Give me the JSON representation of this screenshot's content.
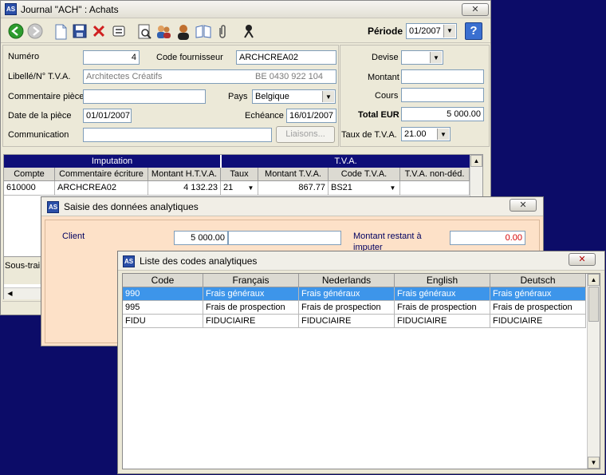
{
  "main": {
    "title": "Journal \"ACH\" : Achats",
    "close": "✕",
    "toolbar": {
      "periode_label": "Période",
      "periode_value": "01/2007",
      "help": "?"
    },
    "form": {
      "numero_label": "Numéro",
      "numero_value": "4",
      "code_fournisseur_label": "Code fournisseur",
      "code_fournisseur_value": "ARCHCREA02",
      "libelle_label": "Libellé/N° T.V.A.",
      "libelle_value": "Architectes Créatifs",
      "tva_number": "BE 0430 922 104",
      "commentaire_label": "Commentaire pièce",
      "commentaire_value": "",
      "pays_label": "Pays",
      "pays_value": "Belgique",
      "date_piece_label": "Date de la pièce",
      "date_piece_value": "01/01/2007",
      "echeance_label": "Echéance",
      "echeance_value": "16/01/2007",
      "communication_label": "Communication",
      "communication_value": "",
      "liaisons_button": "Liaisons...",
      "devise_label": "Devise",
      "devise_value": "",
      "montant_label": "Montant",
      "montant_value": "",
      "cours_label": "Cours",
      "cours_value": "",
      "total_eur_label": "Total EUR",
      "total_eur_value": "5 000.00",
      "taux_tva_label": "Taux de T.V.A.",
      "taux_tva_value": "21.00"
    },
    "grid": {
      "group_imputation": "Imputation",
      "group_tva": "T.V.A.",
      "columns": [
        "Compte",
        "Commentaire écriture",
        "Montant H.T.V.A.",
        "Taux",
        "Montant T.V.A.",
        "Code T.V.A.",
        "T.V.A. non-déd."
      ],
      "row": {
        "compte": "610000",
        "commentaire": "ARCHCREA02",
        "montant_htva": "4 132.23",
        "taux": "21",
        "montant_tva": "867.77",
        "code_tva": "BS21",
        "tva_non_ded": ""
      },
      "footer_label": "Sous-trai"
    }
  },
  "analytic": {
    "title": "Saisie des données analytiques",
    "close": "✕",
    "client_label": "Client",
    "client_value": "5 000.00",
    "montant_restant_label": "Montant restant à imputer",
    "montant_restant_value": "0.00"
  },
  "codes": {
    "title": "Liste des codes analytiques",
    "close": "✕",
    "columns": [
      "Code",
      "Français",
      "Nederlands",
      "English",
      "Deutsch"
    ],
    "rows": [
      [
        "990",
        "Frais généraux",
        "Frais généraux",
        "Frais généraux",
        "Frais généraux"
      ],
      [
        "995",
        "Frais de prospection",
        "Frais de prospection",
        "Frais de prospection",
        "Frais de prospection"
      ],
      [
        "FIDU",
        "FIDUCIAIRE",
        "FIDUCIAIRE",
        "FIDUCIAIRE",
        "FIDUCIAIRE"
      ]
    ],
    "selected_row": 0
  },
  "icons": [
    "back-icon",
    "forward-icon",
    "new-document-icon",
    "save-icon",
    "delete-icon",
    "toggle-icon",
    "preview-icon",
    "users-icon",
    "person-icon",
    "book-icon",
    "attach-icon",
    "agent-icon"
  ],
  "colors": {
    "desktop": "#0c0c68",
    "grid_header": "#0e0e78",
    "analytic_bg": "#fde1c8",
    "selection": "#3d95ea",
    "alert_red": "#d40000"
  }
}
